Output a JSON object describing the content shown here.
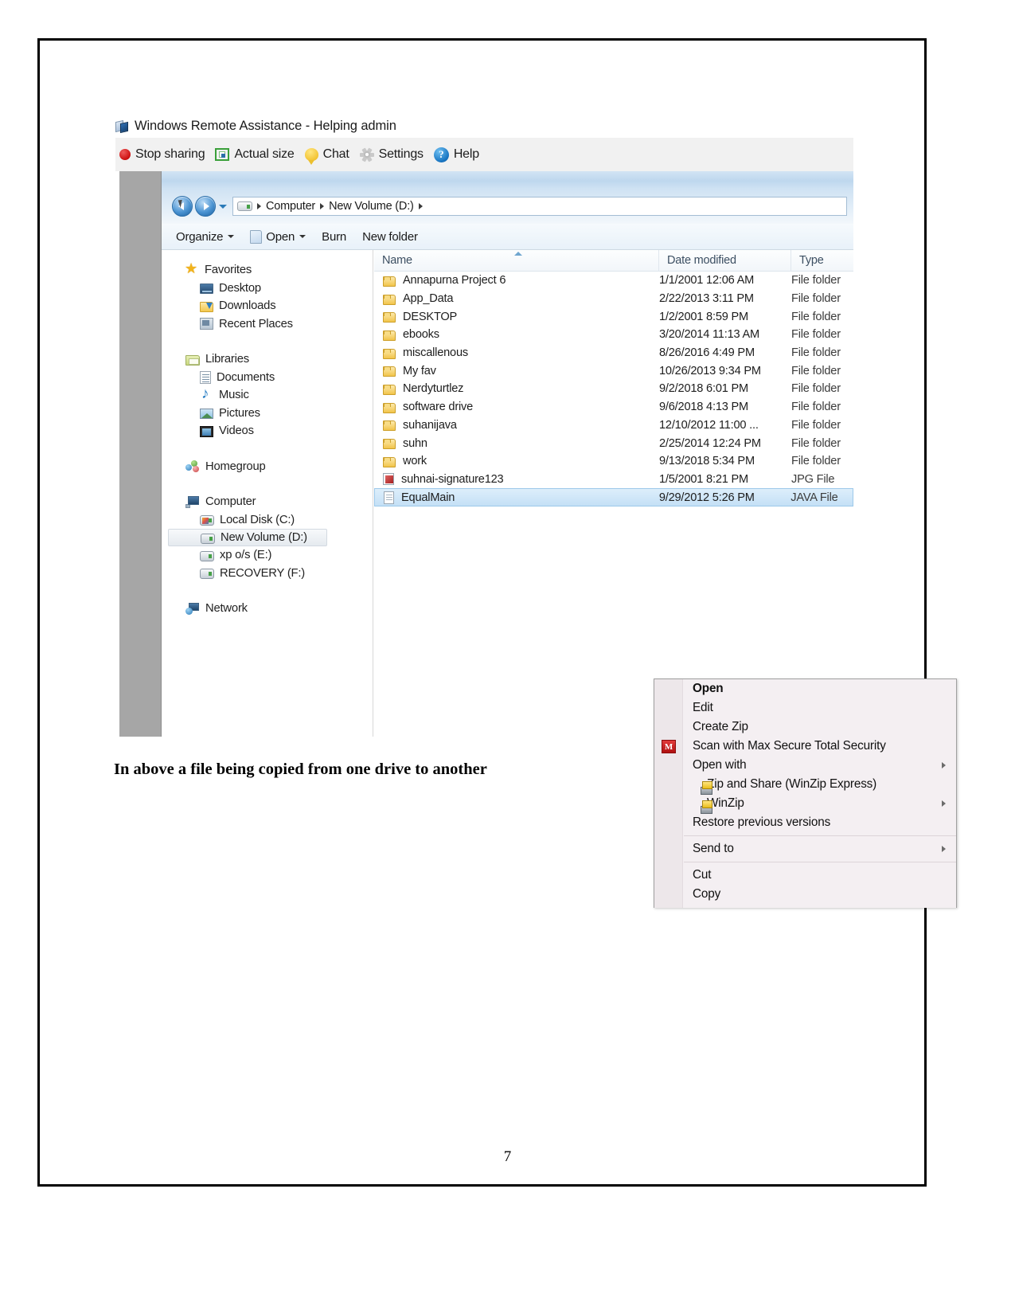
{
  "document": {
    "caption": "In above a file being copied from one drive to another",
    "page_number": "7"
  },
  "remote_assistance": {
    "title": "Windows Remote Assistance - Helping admin",
    "title_icon": "remote-assistance-flag-icon",
    "toolbar": [
      {
        "label": "Stop sharing",
        "icon": "stop-sharing-icon"
      },
      {
        "label": "Actual size",
        "icon": "actual-size-icon"
      },
      {
        "label": "Chat",
        "icon": "chat-bubble-icon"
      },
      {
        "label": "Settings",
        "icon": "gear-icon"
      },
      {
        "label": "Help",
        "icon": "help-circle-icon"
      }
    ]
  },
  "explorer": {
    "breadcrumb": {
      "drive_icon": "drive-icon",
      "segments": [
        "Computer",
        "New Volume (D:)"
      ]
    },
    "nav_buttons": {
      "back": "back-arrow-icon",
      "forward": "forward-arrow-icon",
      "recent_pages": "chevron-down-icon"
    },
    "command_bar": [
      {
        "label": "Organize",
        "caret": true,
        "icon": null
      },
      {
        "label": "Open",
        "caret": true,
        "icon": "open-document-icon"
      },
      {
        "label": "Burn",
        "caret": false,
        "icon": null
      },
      {
        "label": "New folder",
        "caret": false,
        "icon": null
      }
    ],
    "nav_pane": [
      {
        "label": "Favorites",
        "icon": "star-icon",
        "level": 0,
        "selected": false
      },
      {
        "label": "Desktop",
        "icon": "desktop-icon",
        "level": 1,
        "selected": false
      },
      {
        "label": "Downloads",
        "icon": "downloads-folder-icon",
        "level": 1,
        "selected": false
      },
      {
        "label": "Recent Places",
        "icon": "recent-places-icon",
        "level": 1,
        "selected": false
      },
      {
        "label": "Libraries",
        "icon": "libraries-icon",
        "level": 0,
        "selected": false
      },
      {
        "label": "Documents",
        "icon": "documents-icon",
        "level": 1,
        "selected": false
      },
      {
        "label": "Music",
        "icon": "music-icon",
        "level": 1,
        "selected": false
      },
      {
        "label": "Pictures",
        "icon": "pictures-icon",
        "level": 1,
        "selected": false
      },
      {
        "label": "Videos",
        "icon": "videos-icon",
        "level": 1,
        "selected": false
      },
      {
        "label": "Homegroup",
        "icon": "homegroup-icon",
        "level": 0,
        "selected": false
      },
      {
        "label": "Computer",
        "icon": "computer-icon",
        "level": 0,
        "selected": false
      },
      {
        "label": "Local Disk (C:)",
        "icon": "system-drive-icon",
        "level": 1,
        "selected": false
      },
      {
        "label": "New Volume (D:)",
        "icon": "drive-icon",
        "level": 1,
        "selected": true
      },
      {
        "label": "xp o/s (E:)",
        "icon": "drive-icon",
        "level": 1,
        "selected": false
      },
      {
        "label": "RECOVERY (F:)",
        "icon": "drive-icon",
        "level": 1,
        "selected": false
      },
      {
        "label": "Network",
        "icon": "network-icon",
        "level": 0,
        "selected": false
      }
    ],
    "columns": [
      "Name",
      "Date modified",
      "Type"
    ],
    "sort_column": "Name",
    "files": [
      {
        "name": "Annapurna Project 6",
        "date": "1/1/2001 12:06 AM",
        "type": "File folder",
        "icon": "folder-icon",
        "selected": false
      },
      {
        "name": "App_Data",
        "date": "2/22/2013 3:11 PM",
        "type": "File folder",
        "icon": "folder-icon",
        "selected": false
      },
      {
        "name": "DESKTOP",
        "date": "1/2/2001 8:59 PM",
        "type": "File folder",
        "icon": "folder-icon",
        "selected": false
      },
      {
        "name": "ebooks",
        "date": "3/20/2014 11:13 AM",
        "type": "File folder",
        "icon": "folder-icon",
        "selected": false
      },
      {
        "name": "miscallenous",
        "date": "8/26/2016 4:49 PM",
        "type": "File folder",
        "icon": "folder-icon",
        "selected": false
      },
      {
        "name": "My fav",
        "date": "10/26/2013 9:34 PM",
        "type": "File folder",
        "icon": "folder-icon",
        "selected": false
      },
      {
        "name": "Nerdyturtlez",
        "date": "9/2/2018 6:01 PM",
        "type": "File folder",
        "icon": "folder-icon",
        "selected": false
      },
      {
        "name": "software drive",
        "date": "9/6/2018 4:13 PM",
        "type": "File folder",
        "icon": "folder-icon",
        "selected": false
      },
      {
        "name": "suhanijava",
        "date": "12/10/2012 11:00 ...",
        "type": "File folder",
        "icon": "folder-icon",
        "selected": false
      },
      {
        "name": "suhn",
        "date": "2/25/2014 12:24 PM",
        "type": "File folder",
        "icon": "folder-icon",
        "selected": false
      },
      {
        "name": "work",
        "date": "9/13/2018 5:34 PM",
        "type": "File folder",
        "icon": "folder-icon",
        "selected": false
      },
      {
        "name": "suhnai-signature123",
        "date": "1/5/2001 8:21 PM",
        "type": "JPG File",
        "icon": "jpg-file-icon",
        "selected": false
      },
      {
        "name": "EqualMain",
        "date": "9/29/2012 5:26 PM",
        "type": "JAVA File",
        "icon": "java-file-icon",
        "selected": true
      }
    ]
  },
  "context_menu": {
    "items": [
      {
        "label": "Open",
        "bold": true,
        "icon": null,
        "submenu": false,
        "separator_before": false
      },
      {
        "label": "Edit",
        "bold": false,
        "icon": null,
        "submenu": false,
        "separator_before": false
      },
      {
        "label": "Create Zip",
        "bold": false,
        "icon": null,
        "submenu": false,
        "separator_before": false
      },
      {
        "label": "Scan with Max Secure Total Security",
        "bold": false,
        "icon": "max-secure-icon",
        "submenu": false,
        "separator_before": false
      },
      {
        "label": "Open with",
        "bold": false,
        "icon": null,
        "submenu": true,
        "separator_before": false
      },
      {
        "label": "Zip and Share (WinZip Express)",
        "bold": false,
        "icon": "winzip-icon",
        "submenu": false,
        "separator_before": false
      },
      {
        "label": "WinZip",
        "bold": false,
        "icon": "winzip-icon",
        "submenu": true,
        "separator_before": false
      },
      {
        "label": "Restore previous versions",
        "bold": false,
        "icon": null,
        "submenu": false,
        "separator_before": false
      },
      {
        "label": "Send to",
        "bold": false,
        "icon": null,
        "submenu": true,
        "separator_before": true
      },
      {
        "label": "Cut",
        "bold": false,
        "icon": null,
        "submenu": false,
        "separator_before": true
      },
      {
        "label": "Copy",
        "bold": false,
        "icon": null,
        "submenu": false,
        "separator_before": false
      }
    ],
    "max_secure_glyph": "M"
  },
  "colors": {
    "accent_selection": "#c4e0f6",
    "toolbar_bg": "#f1f1f1",
    "menu_bg": "#f4eff2",
    "stop_red": "#cc1010",
    "help_blue": "#1673c0",
    "folder_yellow": "#f2c44a"
  }
}
